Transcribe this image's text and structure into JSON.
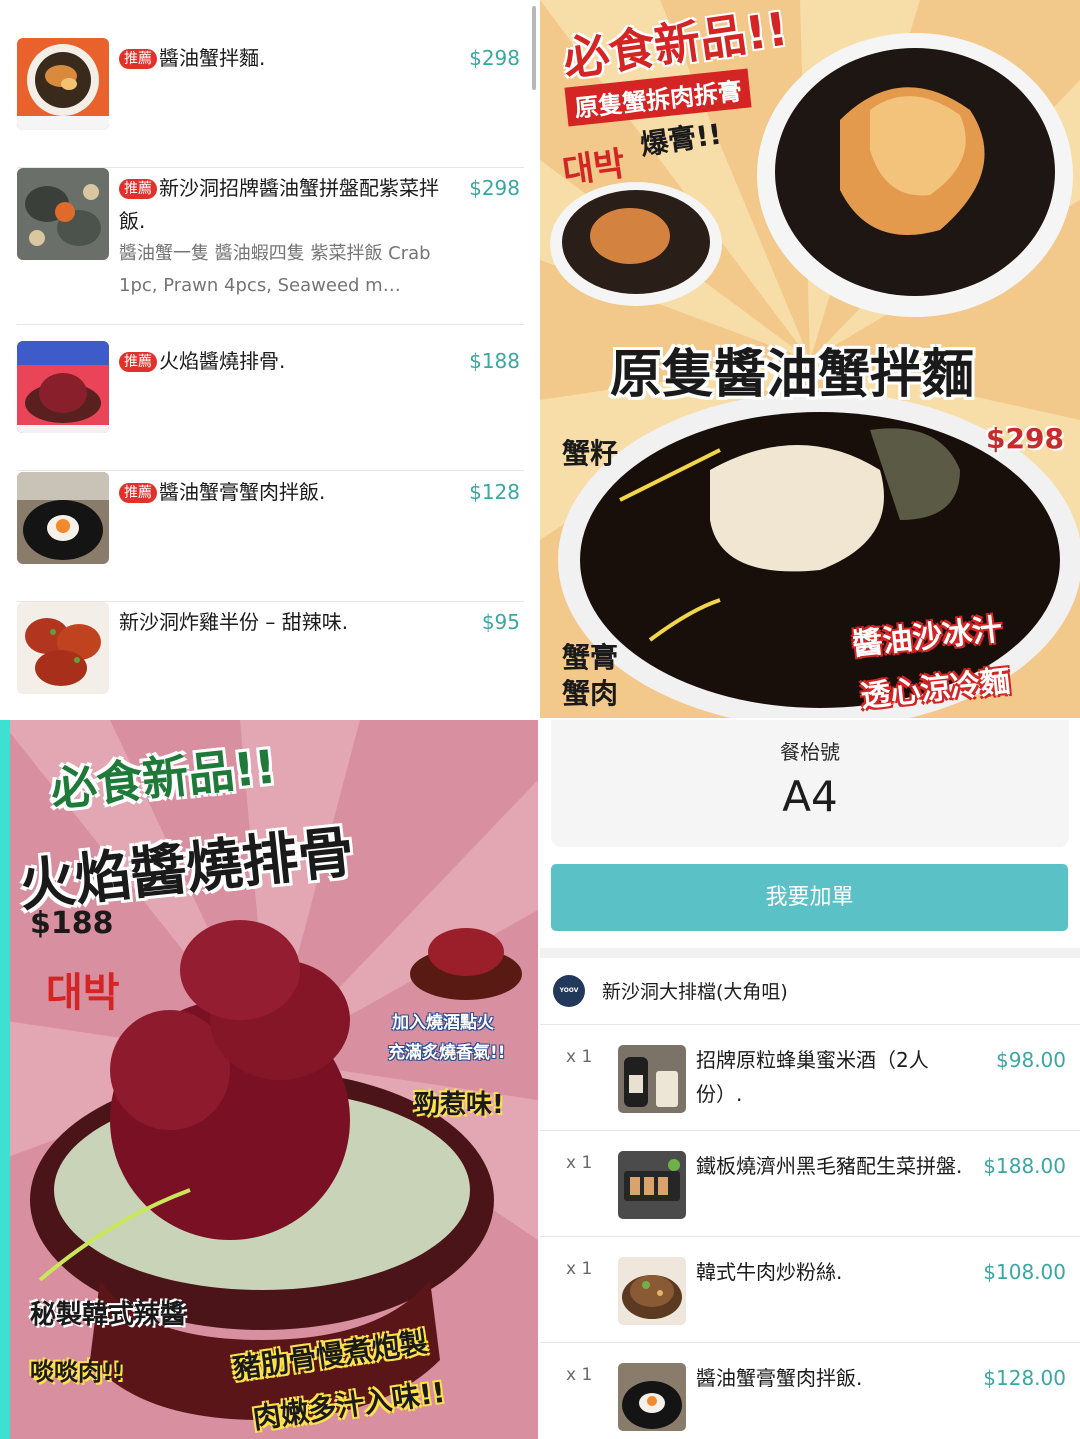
{
  "menu": {
    "recommended_badge": "推薦",
    "items": [
      {
        "title": "醬油蟹拌麵.",
        "recommended": true,
        "description": "",
        "price": "$298"
      },
      {
        "title": "新沙洞招牌醬油蟹拼盤配紫菜拌飯.",
        "recommended": true,
        "description": "醬油蟹一隻 醬油蝦四隻 紫菜拌飯 Crab 1pc, Prawn 4pcs, Seaweed m…",
        "price": "$298"
      },
      {
        "title": "火焰醬燒排骨.",
        "recommended": true,
        "description": "",
        "price": "$188"
      },
      {
        "title": "醬油蟹膏蟹肉拌飯.",
        "recommended": true,
        "description": "",
        "price": "$128"
      },
      {
        "title": "新沙洞炸雞半份 – 甜辣味.",
        "recommended": false,
        "description": "",
        "price": "$95"
      }
    ]
  },
  "poster_crab": {
    "headline": "必食新品!!",
    "subtitle": "原隻蟹拆肉拆膏",
    "korean": "대박",
    "burst": "爆膏!!",
    "title": "原隻醬油蟹拌麵",
    "price": "$298",
    "label_roe": "蟹籽",
    "label_meat": "蟹膏\n蟹肉",
    "tag_sauce": "醬油沙冰汁",
    "tag_cold": "透心涼冷麵"
  },
  "poster_ribs": {
    "headline": "必食新品!!",
    "title": "火焰醬燒排骨",
    "price": "$188",
    "korean": "대박",
    "fire_line1": "加入燒酒點火",
    "fire_line2": "充滿炙燒香氣!!",
    "strong": "勁惹味!",
    "secret_sauce": "秘製韓式辣醬",
    "chewy": "啖啖肉!!",
    "ribs_line": "豬肋骨慢煮炮製",
    "juicy_line": "肉嫩多汁入味!!"
  },
  "order": {
    "table_label": "餐枱號",
    "table_number": "A4",
    "add_button": "我要加單",
    "shop_logo_text": "YOOV",
    "shop_name": "新沙洞大排檔(大角咀)",
    "items": [
      {
        "qty": "x 1",
        "name": "招牌原粒蜂巢蜜米酒（2人份）.",
        "price": "$98.00"
      },
      {
        "qty": "x 1",
        "name": "鐵板燒濟州黑毛豬配生菜拼盤.",
        "price": "$188.00"
      },
      {
        "qty": "x 1",
        "name": "韓式牛肉炒粉絲.",
        "price": "$108.00"
      },
      {
        "qty": "x 1",
        "name": "醬油蟹膏蟹肉拌飯.",
        "price": "$128.00"
      }
    ]
  },
  "colors": {
    "accent_teal": "#5ac2c7",
    "price_teal": "#3aa7a3",
    "badge_red": "#e0322b"
  }
}
